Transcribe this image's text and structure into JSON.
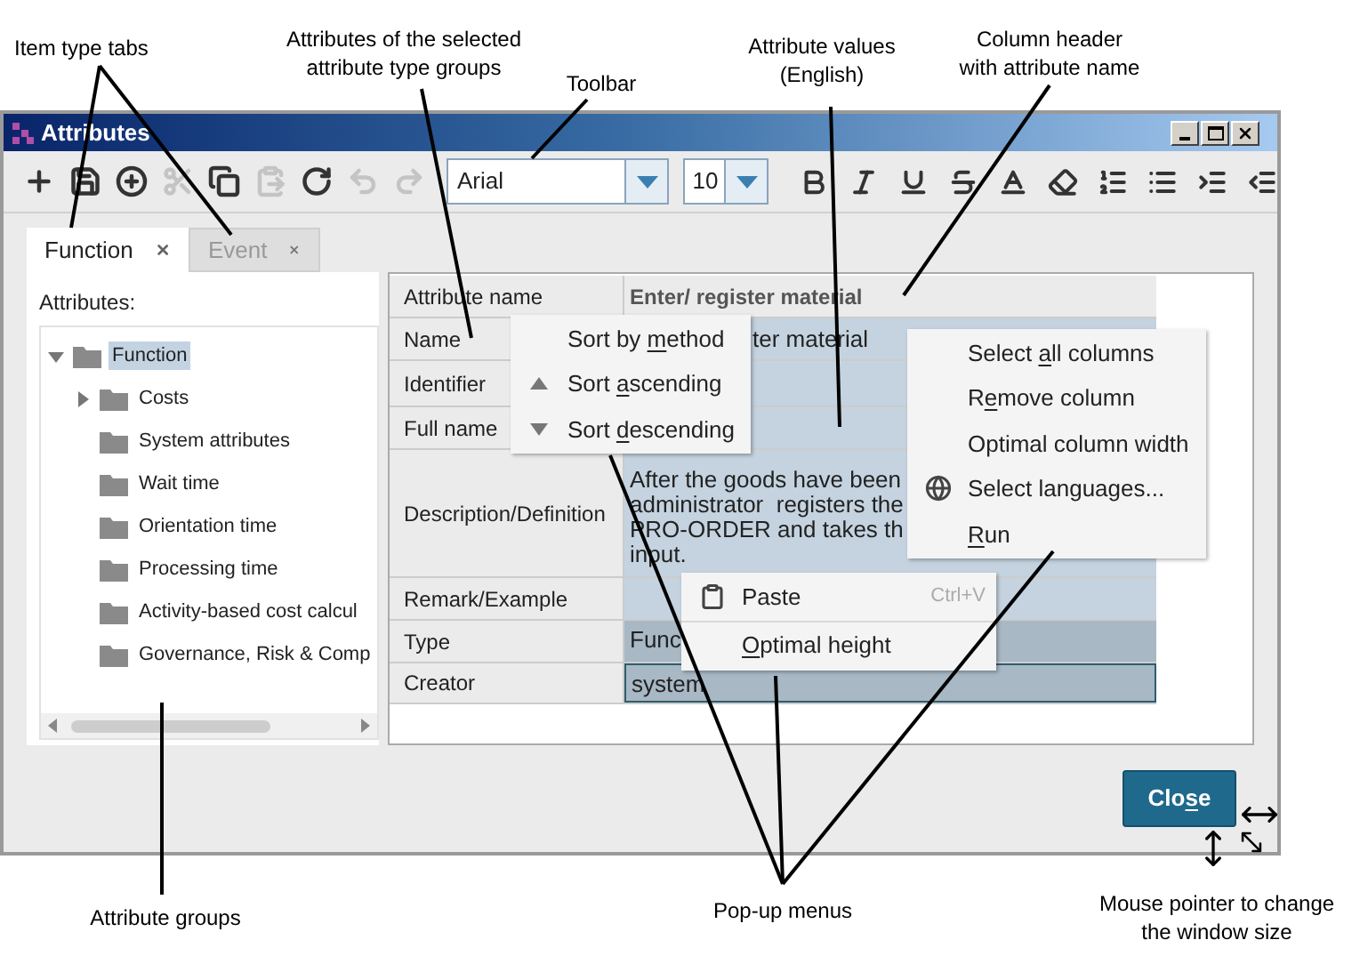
{
  "annotations": [
    {
      "lines": [
        "Item type tabs"
      ]
    },
    {
      "lines": [
        "Attributes of the selected",
        "attribute type groups"
      ]
    },
    {
      "lines": [
        "Toolbar"
      ]
    },
    {
      "lines": [
        "Attribute values",
        "(English)"
      ]
    },
    {
      "lines": [
        "Column header",
        "with attribute name"
      ]
    },
    {
      "lines": [
        "Attribute groups"
      ]
    },
    {
      "lines": [
        "Pop-up menus"
      ]
    },
    {
      "lines": [
        "Mouse pointer to change",
        "the window size"
      ]
    }
  ],
  "window": {
    "title": "Attributes"
  },
  "toolbar": {
    "buttons": [
      {
        "disabled": false
      },
      {
        "disabled": false
      },
      {
        "disabled": false
      },
      {
        "disabled": true
      },
      {
        "disabled": false
      },
      {
        "disabled": true
      },
      {
        "disabled": false
      },
      {
        "disabled": true
      },
      {
        "disabled": true
      }
    ],
    "font": "Arial",
    "size": "10"
  },
  "tabs": [
    {
      "label": "Function",
      "selected": true
    },
    {
      "label": "Event",
      "selected": false
    }
  ],
  "attributes_label": "Attributes:",
  "tree": [
    {
      "label": "Function",
      "selected": true,
      "expandable": true,
      "expanded": true,
      "children": [
        {
          "label": "Costs",
          "selected": false,
          "expandable": true,
          "expanded": false
        },
        {
          "label": "System attributes",
          "selected": false,
          "expandable": false
        },
        {
          "label": "Wait time",
          "selected": false,
          "expandable": false
        },
        {
          "label": "Orientation time",
          "selected": false,
          "expandable": false
        },
        {
          "label": "Processing time",
          "selected": false,
          "expandable": false
        },
        {
          "label": "Activity-based cost calcul",
          "selected": false,
          "expandable": false
        },
        {
          "label": "Governance, Risk & Comp",
          "selected": false,
          "expandable": false
        }
      ]
    }
  ],
  "table": {
    "columns": [
      "Attribute name",
      "Enter/ register material"
    ],
    "rows": [
      {
        "name": "Name",
        "value": [
          "ter material"
        ],
        "selected": true,
        "readonly": false,
        "focused": false
      },
      {
        "name": "Identifier",
        "selected": true,
        "readonly": false,
        "focused": false
      },
      {
        "name": "Full name",
        "selected": true,
        "readonly": false,
        "focused": false
      },
      {
        "name": "Description/Definition",
        "value": [
          "After the goods have been",
          "administrator  registers the",
          "PRO-ORDER and takes th",
          "input."
        ],
        "selected": true,
        "readonly": false,
        "focused": false
      },
      {
        "name": "Remark/Example",
        "selected": true,
        "readonly": false,
        "focused": false
      },
      {
        "name": "Type",
        "value": [
          "Func"
        ],
        "selected": true,
        "readonly": true,
        "focused": false
      },
      {
        "name": "Creator",
        "value": [
          "system"
        ],
        "selected": true,
        "readonly": true,
        "focused": true
      }
    ]
  },
  "sort_menu": [
    {
      "kind": "plain",
      "label": [
        {
          "text": "Sort by ",
          "underline": false
        },
        {
          "text": "m",
          "underline": true
        },
        {
          "text": "ethod",
          "underline": false
        }
      ]
    },
    {
      "kind": "ascending",
      "label": [
        {
          "text": "Sort ",
          "underline": false
        },
        {
          "text": "a",
          "underline": true
        },
        {
          "text": "scending",
          "underline": false
        }
      ]
    },
    {
      "kind": "descending",
      "label": [
        {
          "text": "Sort ",
          "underline": false
        },
        {
          "text": "d",
          "underline": true
        },
        {
          "text": "escending",
          "underline": false
        }
      ]
    }
  ],
  "column_menu": [
    {
      "kind": "plain",
      "label": [
        {
          "text": "Select ",
          "underline": false
        },
        {
          "text": "a",
          "underline": true
        },
        {
          "text": "ll columns",
          "underline": false
        }
      ]
    },
    {
      "kind": "plain",
      "label": [
        {
          "text": "R",
          "underline": false
        },
        {
          "text": "e",
          "underline": true
        },
        {
          "text": "move column",
          "underline": false
        }
      ]
    },
    {
      "kind": "plain",
      "label": [
        {
          "text": "Optimal column width",
          "underline": false
        }
      ]
    },
    {
      "kind": "language",
      "label": [
        {
          "text": "Select languages...",
          "underline": false
        }
      ]
    },
    {
      "kind": "plain",
      "label": [
        {
          "text": "R",
          "underline": true
        },
        {
          "text": "un",
          "underline": false
        }
      ]
    }
  ],
  "paste_menu": [
    {
      "kind": "paste",
      "label": [
        {
          "text": "Paste",
          "underline": false
        }
      ],
      "shortcut": "Ctrl+V"
    },
    {
      "kind": "plain",
      "label": [
        {
          "text": "O",
          "underline": true
        },
        {
          "text": "ptimal height",
          "underline": false
        }
      ]
    }
  ],
  "close_button": {
    "label": [
      {
        "text": "Clo",
        "underline": false
      },
      {
        "text": "s",
        "underline": true
      },
      {
        "text": "e",
        "underline": false
      }
    ]
  }
}
